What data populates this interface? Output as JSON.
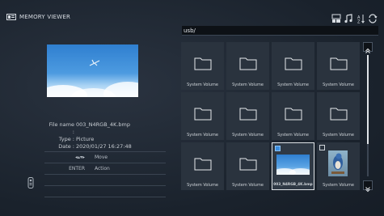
{
  "header": {
    "title": "MEMORY VIEWER",
    "title_icon": "memory-viewer-icon",
    "top_icons": [
      "view-mode-icon",
      "music-note-icon",
      "sort-az-icon",
      "repeat-icon"
    ]
  },
  "preview": {
    "file_name_label": "File name :",
    "file_name": "003_N4RGB_4K.bmp",
    "type_label": "Type :",
    "type": "Picture",
    "date_label": "Date :",
    "date": "2020/01/27 16:27:48"
  },
  "help": {
    "rows": [
      {
        "key": "◂▴▾▸",
        "action": "Move"
      },
      {
        "key": "ENTER",
        "action": "Action"
      }
    ]
  },
  "path": "usb/",
  "tiles": [
    {
      "label": "System Volume",
      "kind": "folder"
    },
    {
      "label": "System Volume",
      "kind": "folder"
    },
    {
      "label": "System Volume",
      "kind": "folder"
    },
    {
      "label": "System Volume",
      "kind": "folder"
    },
    {
      "label": "System Volume",
      "kind": "folder"
    },
    {
      "label": "System Volume",
      "kind": "folder"
    },
    {
      "label": "System Volume",
      "kind": "folder"
    },
    {
      "label": "System Volume",
      "kind": "folder"
    },
    {
      "label": "System Volume",
      "kind": "folder"
    },
    {
      "label": "System Volume",
      "kind": "folder"
    },
    {
      "label": "003_N4RGB_4K.bmp",
      "kind": "image-sky",
      "checked": true,
      "selected": true
    },
    {
      "label": "System Volume",
      "kind": "image-bird",
      "checked": false
    }
  ],
  "scroll": {
    "position_fraction": 0.0,
    "visible_fraction": 0.73
  },
  "colors": {
    "accent": "#3a8de0",
    "background": "#1b2430",
    "tile": "#2a333e"
  }
}
